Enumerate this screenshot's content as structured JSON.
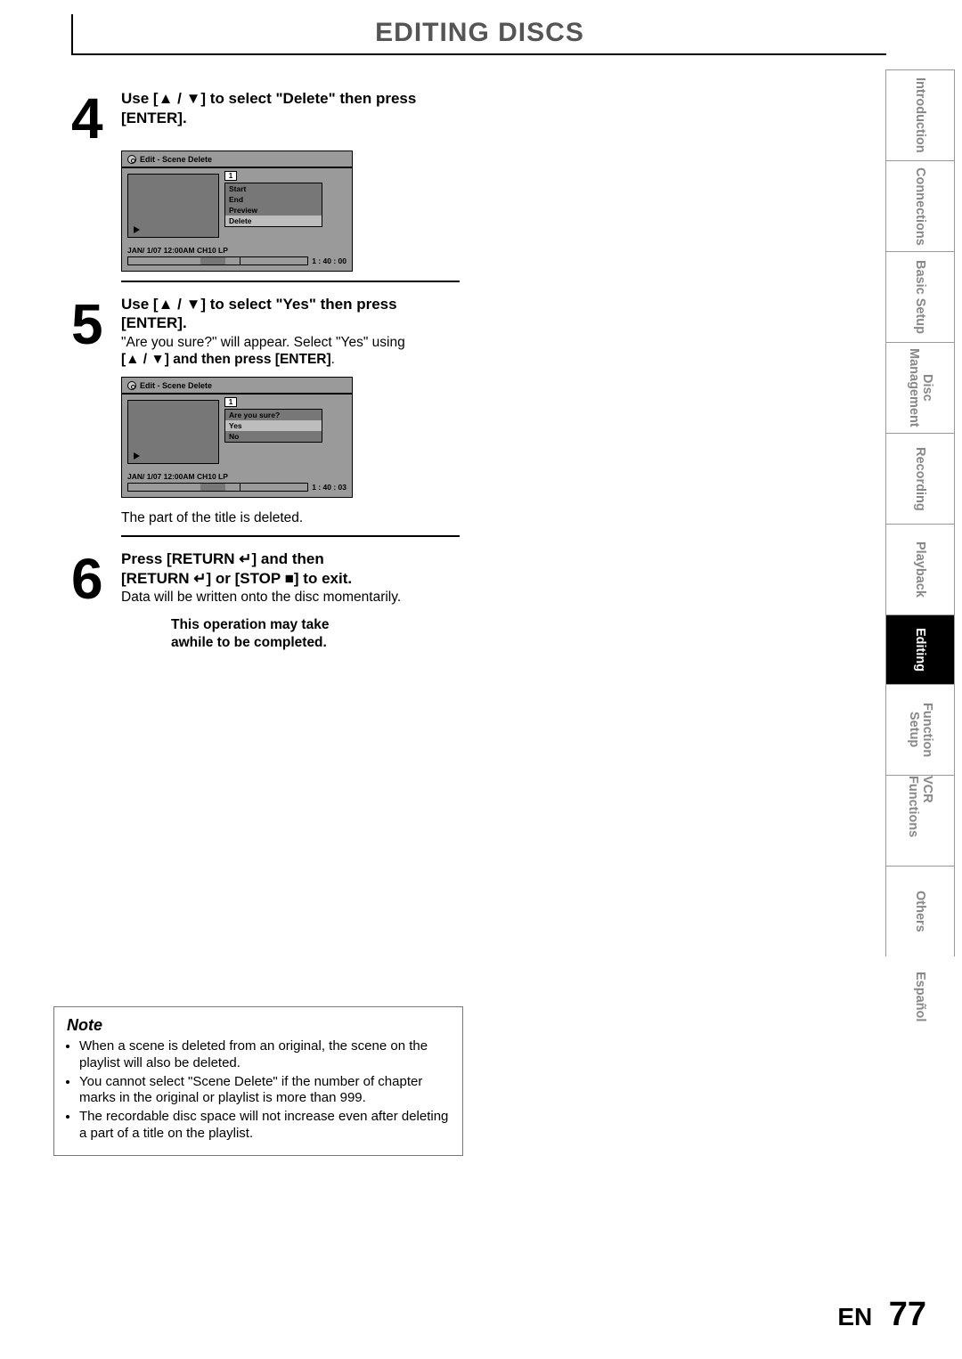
{
  "header": {
    "title": "EDITING DISCS"
  },
  "step4": {
    "num": "4",
    "instr_pre": "Use [",
    "instr_mid": " / ",
    "instr_post": "] to select \"Delete\" then press [ENTER].",
    "screen": {
      "title": "Edit - Scene Delete",
      "index": "1",
      "menu": [
        "Start",
        "End",
        "Preview",
        "Delete"
      ],
      "highlight": 3,
      "footer": "JAN/ 1/07 12:00AM CH10   LP",
      "time": "1 : 40 : 00"
    }
  },
  "step5": {
    "num": "5",
    "instr": "Use [▲ / ▼] to select \"Yes\" then press [ENTER].",
    "desc1": "\"Are you sure?\" will appear. Select \"Yes\" using",
    "desc2": "[▲ / ▼] and then press ",
    "desc2b": "[ENTER]",
    "desc2c": ".",
    "screen": {
      "title": "Edit - Scene Delete",
      "index": "1",
      "menu": [
        "Are you sure?",
        "Yes",
        "No"
      ],
      "highlight": 1,
      "footer": "JAN/ 1/07 12:00AM CH10   LP",
      "time": "1 : 40 : 03"
    },
    "after": "The part of the title is deleted."
  },
  "step6": {
    "num": "6",
    "line1a": "Press [RETURN ",
    "line1b": "] and then",
    "line2a": "[RETURN ",
    "line2b": "] or [STOP ",
    "line2c": "] to exit.",
    "desc": "Data will be written onto the disc momentarily.",
    "warn1": "This operation may take",
    "warn2": "awhile to be completed."
  },
  "note": {
    "title": "Note",
    "items": [
      "When a scene is deleted from an original, the scene on the playlist will also be deleted.",
      "You cannot select \"Scene Delete\" if the number of chapter marks in the original or playlist is more than 999.",
      "The recordable disc space will not increase even after deleting a part of a title on the playlist."
    ]
  },
  "tabs": [
    "Introduction",
    "Connections",
    "Basic Setup",
    "Disc\nManagement",
    "Recording",
    "Playback",
    "Editing",
    "Function\nSetup",
    "VCR Functions",
    "Others",
    "Español"
  ],
  "footer": {
    "lang": "EN",
    "page": "77"
  }
}
